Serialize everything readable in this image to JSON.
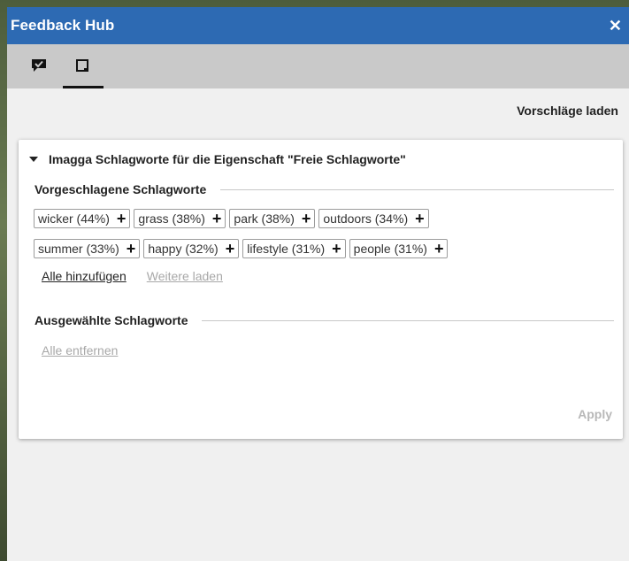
{
  "window": {
    "title": "Feedback Hub",
    "close_label": "✕"
  },
  "tabs": [
    {
      "icon": "feedback-check-icon",
      "active": false
    },
    {
      "icon": "tag-list-icon",
      "active": true
    }
  ],
  "toolbar": {
    "load_suggestions": "Vorschläge laden"
  },
  "card": {
    "title": "Imagga Schlagworte für die Eigenschaft \"Freie Schlagworte\"",
    "suggested": {
      "label": "Vorgeschlagene Schlagworte",
      "row1": [
        "wicker (44%)",
        "grass (38%)",
        "park (38%)",
        "outdoors (34%)"
      ],
      "row2": [
        "summer (33%)",
        "happy (32%)",
        "lifestyle (31%)",
        "people (31%)"
      ],
      "add_all": "Alle hinzufügen",
      "load_more": "Weitere laden"
    },
    "selected": {
      "label": "Ausgewählte Schlagworte",
      "remove_all": "Alle entfernen"
    },
    "apply": "Apply"
  }
}
